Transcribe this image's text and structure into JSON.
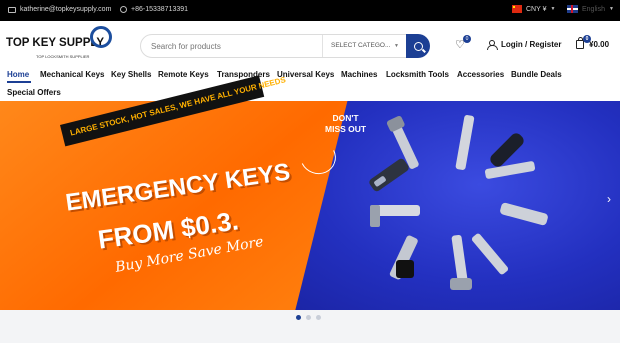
{
  "topbar": {
    "email": "katherine@topkeysupply.com",
    "phone": "+86-15338713391",
    "currency": "CNY ¥",
    "language": "English"
  },
  "header": {
    "logo_name": "TOP KEY SUPPLY",
    "logo_tagline": "TOP LOCKSMITH SUPPLIER",
    "search_placeholder": "Search for products",
    "category_select": "SELECT CATEGO...",
    "wishlist_count": "0",
    "login_label": "Login / Register",
    "cart_count": "0",
    "cart_total": "¥0.00"
  },
  "nav": {
    "items": [
      "Home",
      "Mechanical Keys",
      "Key Shells",
      "Remote Keys",
      "Transponders",
      "Universal Keys",
      "Machines",
      "Locksmith Tools",
      "Accessories",
      "Bundle Deals",
      "Special Offers"
    ]
  },
  "banner": {
    "ribbon": "LARGE STOCK, HOT SALES, WE HAVE ALL YOUR NEEDS",
    "headline": "EMERGENCY KEYS",
    "price_line": "FROM $0.3.",
    "tagline": "Buy More Save More",
    "callout_line1": "DON'T",
    "callout_line2": "MISS OUT",
    "slides": 3,
    "active_slide": 1
  },
  "colors": {
    "brand_blue": "#1c3f94",
    "banner_orange": "#ff7a0a",
    "banner_blue": "#2a37c8"
  }
}
